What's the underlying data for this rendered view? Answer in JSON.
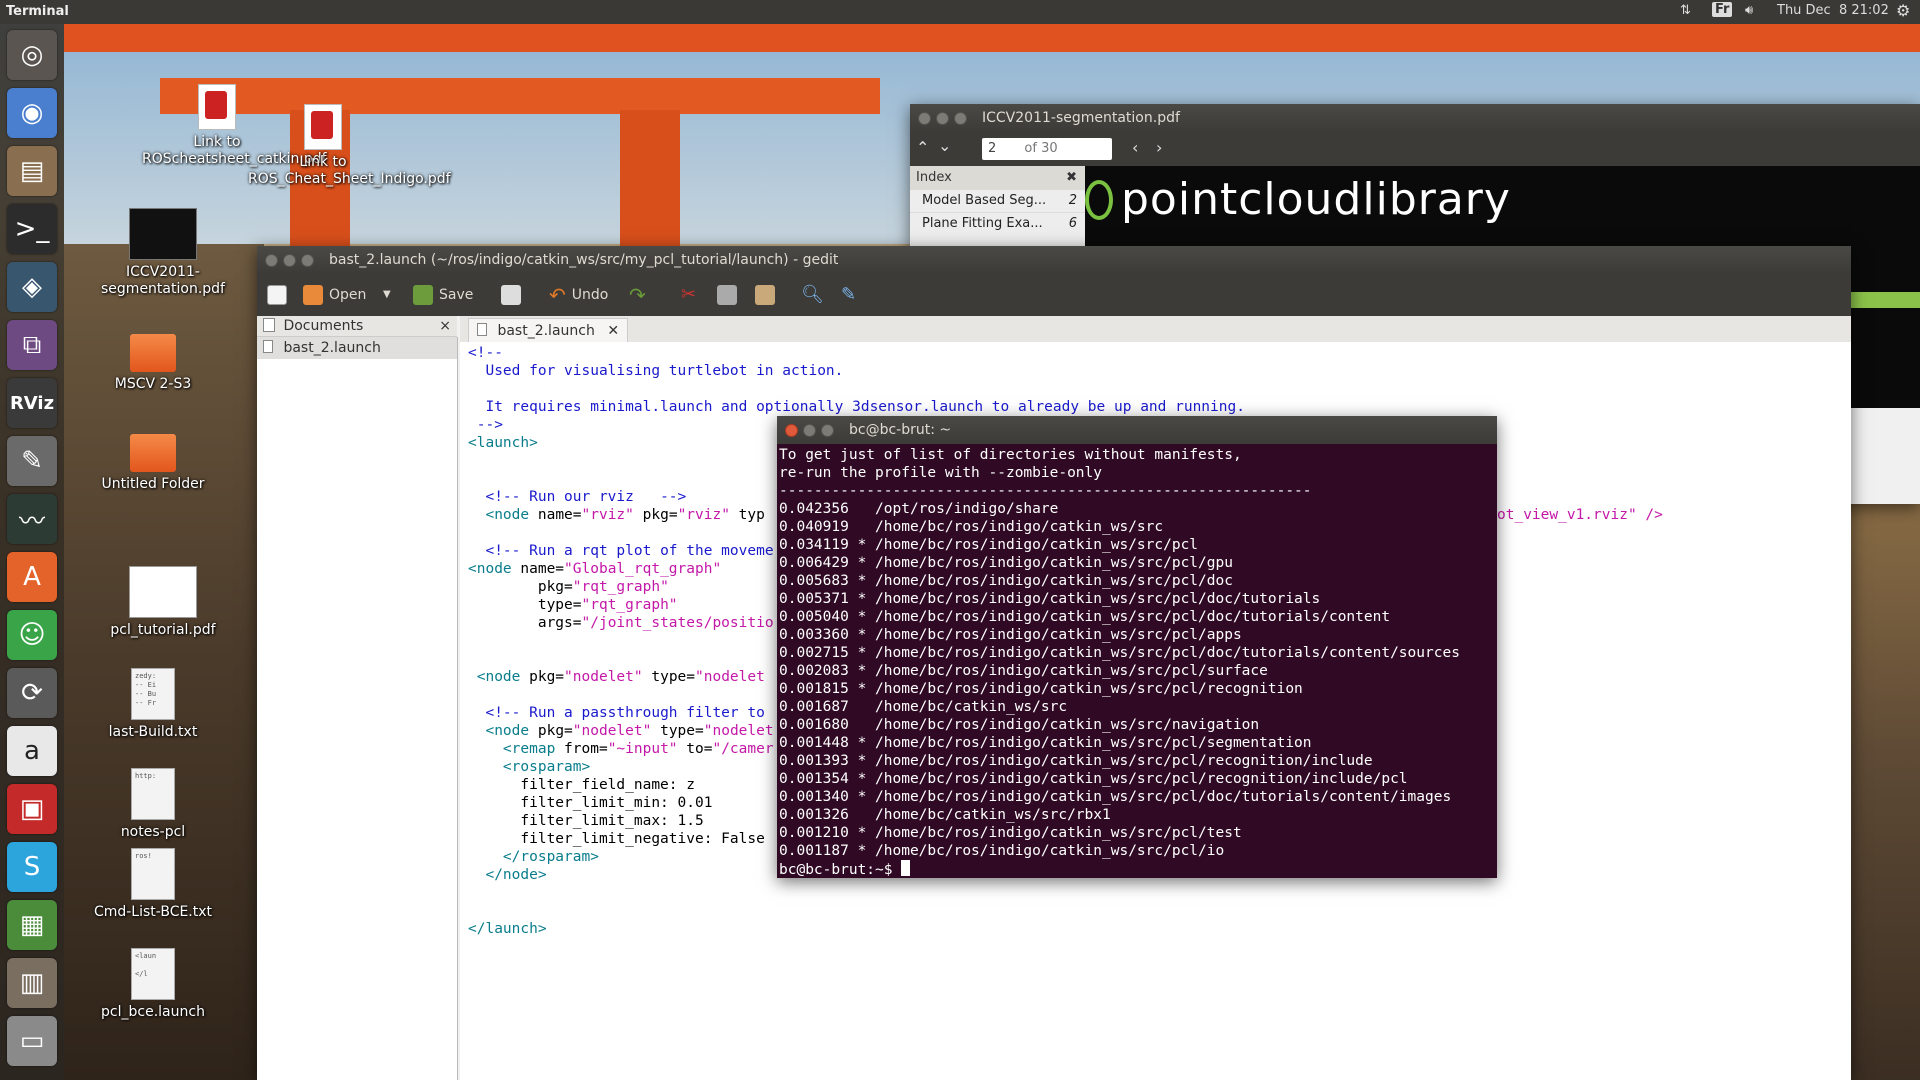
{
  "topbar": {
    "app_title": "Terminal",
    "keyboard_indicator": "Fr",
    "clock": "Thu Dec  8 21:02"
  },
  "launcher": {
    "items": [
      {
        "icon": "ubuntu-dash-icon",
        "color": "#5a5550"
      },
      {
        "icon": "chrome-icon",
        "color": "#4a7fd0"
      },
      {
        "icon": "file-manager-icon",
        "color": "#8a6e50"
      },
      {
        "icon": "terminal-icon",
        "color": "#2c2c2c"
      },
      {
        "icon": "virtualbox-icon",
        "color": "#39566f"
      },
      {
        "icon": "remote-desktop-icon",
        "color": "#6e4a82"
      },
      {
        "icon": "rviz-icon",
        "color": "#3a3a3a",
        "label": "RViz"
      },
      {
        "icon": "text-editor-icon",
        "color": "#6a6a6a"
      },
      {
        "icon": "system-monitor-icon",
        "color": "#2d3b35"
      },
      {
        "icon": "software-center-icon",
        "color": "#e4632a"
      },
      {
        "icon": "messaging-icon",
        "color": "#3aa548"
      },
      {
        "icon": "updater-icon",
        "color": "#5a5a5a"
      },
      {
        "icon": "amazon-icon",
        "color": "#e8e8e8"
      },
      {
        "icon": "pdf-viewer-icon",
        "color": "#c52a2a"
      },
      {
        "icon": "skype-icon",
        "color": "#2ca4dc"
      },
      {
        "icon": "spreadsheet-icon",
        "color": "#4a8c3a"
      },
      {
        "icon": "archive-icon",
        "color": "#7a6e60"
      },
      {
        "icon": "trash-icon",
        "color": "#8a8a8a"
      }
    ]
  },
  "desktop": {
    "icons": [
      {
        "label": "Link to ROScheatsheet_catkin.pdf",
        "kind": "pdf"
      },
      {
        "label": "Link to ROS_Cheat_Sheet_Indigo.pdf",
        "kind": "pdf"
      },
      {
        "label": "ICCV2011-segmentation.pdf",
        "kind": "pdf-thumb"
      },
      {
        "label": "MSCV 2-S3",
        "kind": "folder"
      },
      {
        "label": "Untitled Folder",
        "kind": "folder"
      },
      {
        "label": "pcl_tutorial.pdf",
        "kind": "pdf-thumb"
      },
      {
        "label": "last-Build.txt",
        "kind": "text",
        "preview": "zedy:\n-- Ei\n-- Bu\n-- Fr"
      },
      {
        "label": "notes-pcl",
        "kind": "text",
        "preview": "http:"
      },
      {
        "label": "Cmd-List-BCE.txt",
        "kind": "text",
        "preview": "ros!"
      },
      {
        "label": "pcl_bce.launch",
        "kind": "text",
        "preview": "<laun\n\n</l"
      }
    ]
  },
  "pdf_viewer": {
    "title": "ICCV2011-segmentation.pdf",
    "page_current": "2",
    "page_total": "of 30",
    "sidebar_header": "Index",
    "index_items": [
      {
        "title": "Model Based Seg...",
        "page": "2"
      },
      {
        "title": "Plane Fitting Exa...",
        "page": "6"
      }
    ],
    "banner_text": "pointcloudlibrary"
  },
  "gedit": {
    "title": "bast_2.launch (~/ros/indigo/catkin_ws/src/my_pcl_tutorial/launch) - gedit",
    "toolbar": {
      "open_label": "Open",
      "save_label": "Save",
      "undo_label": "Undo"
    },
    "side_panel_header": "Documents",
    "side_panel_items": [
      "bast_2.launch"
    ],
    "tab_label": "bast_2.launch",
    "file_visible_tail": "ot_view_v1.rviz\" />"
  },
  "terminal": {
    "title": "bc@bc-brut: ~",
    "prompt": "bc@bc-brut:~$ "
  }
}
